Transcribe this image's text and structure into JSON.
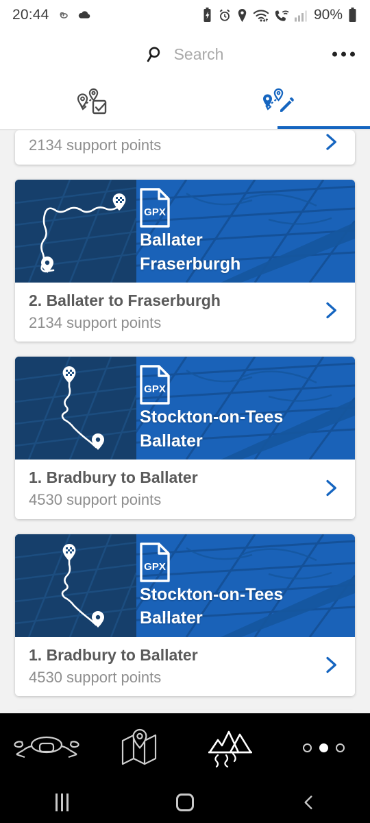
{
  "status_bar": {
    "time": "20:44",
    "battery_percent": "90%",
    "left_icons": [
      "link-icon",
      "cloud-icon"
    ],
    "right_icons": [
      "battery-saver-icon",
      "alarm-icon",
      "location-icon",
      "wifi-icon",
      "wifi-calling-icon",
      "signal-bars-icon",
      "battery-icon"
    ]
  },
  "header": {
    "search_placeholder": "Search",
    "search_value": "",
    "overflow_label": "more-options"
  },
  "tabs": [
    {
      "name": "tab-planned-routes",
      "icon": "route-checkbox-icon",
      "active": false
    },
    {
      "name": "tab-edit-routes",
      "icon": "route-pencil-icon",
      "active": true
    }
  ],
  "colors": {
    "accent": "#1565c0",
    "hero_blue": "#1a62b8",
    "hero_dark": "#163f6b",
    "title_gray": "#5a5a5a",
    "sub_gray": "#8e8e8e",
    "page_bg": "#f2f2f2"
  },
  "partial_top_card": {
    "subtitle": "2134 support points"
  },
  "cards": [
    {
      "hero_line1": "Ballater",
      "hero_line2": "Fraserburgh",
      "title": "2. Ballater to Fraserburgh",
      "subtitle": "2134 support points",
      "badge": "GPX",
      "start_pin": "pin-icon",
      "end_pin": "checkered-flag-pin-icon",
      "route_shape": "horizontal-s-curve"
    },
    {
      "hero_line1": "Stockton-on-Tees",
      "hero_line2": "Ballater",
      "title": "1. Bradbury to Ballater",
      "subtitle": "4530 support points",
      "badge": "GPX",
      "start_pin": "checkered-flag-pin-icon",
      "end_pin": "pin-icon",
      "route_shape": "vertical-zigzag"
    },
    {
      "hero_line1": "Stockton-on-Tees",
      "hero_line2": "Ballater",
      "title": "1. Bradbury to Ballater",
      "subtitle": "4530 support points",
      "badge": "GPX",
      "start_pin": "checkered-flag-pin-icon",
      "end_pin": "pin-icon",
      "route_shape": "vertical-zigzag"
    }
  ],
  "bottom_nav": [
    {
      "name": "nav-motorcycle",
      "icon": "handlebar-icon",
      "active": false
    },
    {
      "name": "nav-map",
      "icon": "folded-map-pin-icon",
      "active": false
    },
    {
      "name": "nav-routes",
      "icon": "mountains-icon",
      "active": true
    },
    {
      "name": "nav-more",
      "icon": "three-dots-icon",
      "active": false
    }
  ],
  "system_nav": [
    {
      "name": "recents-button",
      "icon": "recents-icon"
    },
    {
      "name": "home-button",
      "icon": "home-icon"
    },
    {
      "name": "back-button",
      "icon": "back-chevron-icon"
    }
  ]
}
